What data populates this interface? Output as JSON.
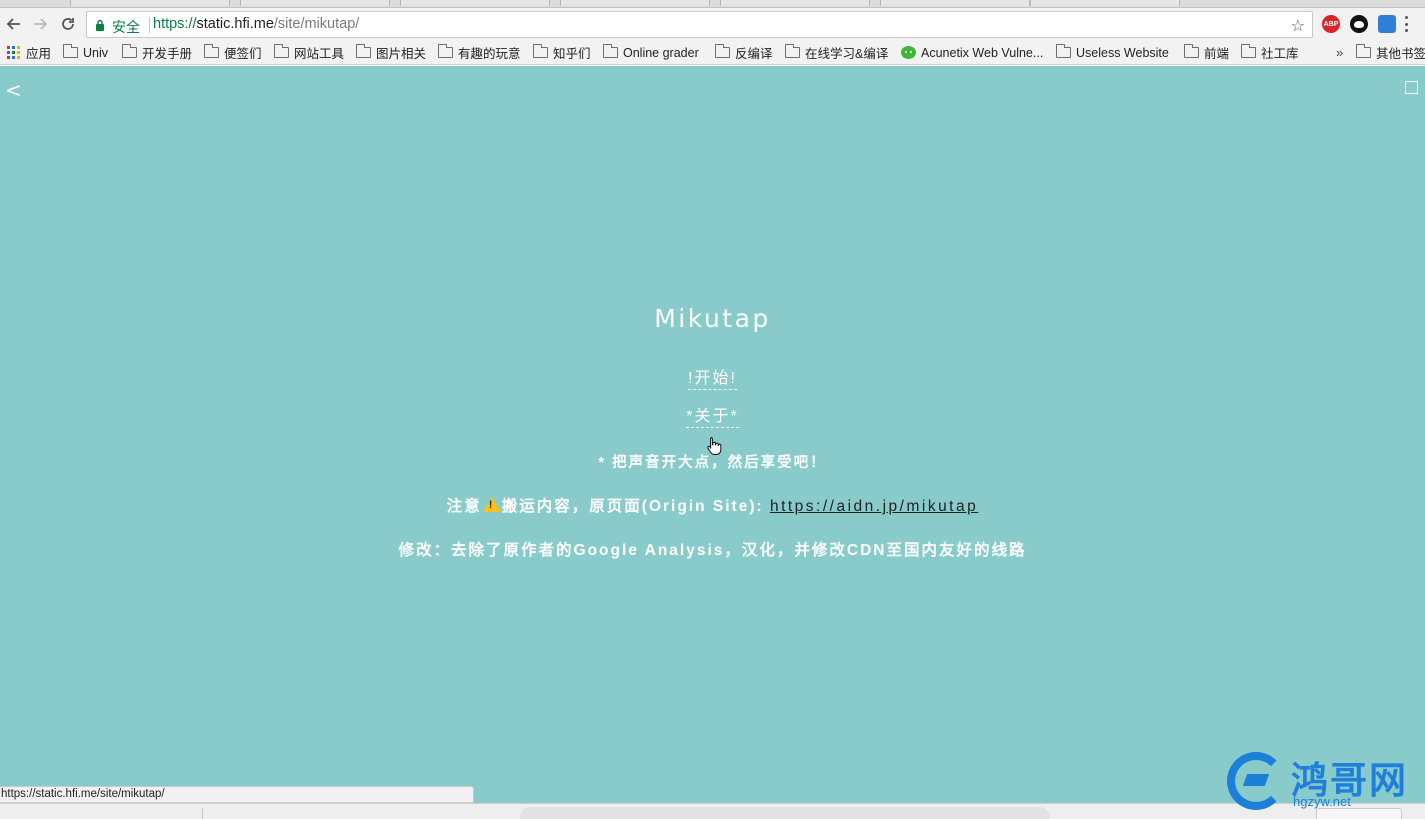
{
  "browser": {
    "omnibox": {
      "security_label": "安全",
      "url_scheme": "https://",
      "url_host": "static.hfi.me",
      "url_path": "/site/mikutap/"
    },
    "extensions": {
      "abp_label": "ABP"
    },
    "bookmarks": [
      {
        "label": "应用",
        "icon": "apps-grid-icon"
      },
      {
        "label": "Univ",
        "icon": "folder-icon"
      },
      {
        "label": "开发手册",
        "icon": "folder-icon"
      },
      {
        "label": "便签们",
        "icon": "folder-icon"
      },
      {
        "label": "网站工具",
        "icon": "folder-icon"
      },
      {
        "label": "图片相关",
        "icon": "folder-icon"
      },
      {
        "label": "有趣的玩意",
        "icon": "folder-icon"
      },
      {
        "label": "知乎们",
        "icon": "folder-icon"
      },
      {
        "label": "Online grader",
        "icon": "folder-icon"
      },
      {
        "label": "反编译",
        "icon": "folder-icon"
      },
      {
        "label": "在线学习&编译",
        "icon": "folder-icon"
      },
      {
        "label": "Acunetix Web Vulne...",
        "icon": "wechat-icon"
      },
      {
        "label": "Useless Website",
        "icon": "folder-icon"
      },
      {
        "label": "前端",
        "icon": "folder-icon"
      },
      {
        "label": "社工库",
        "icon": "folder-icon"
      }
    ],
    "overflow_label": "»",
    "other_bookmarks": "其他书签",
    "status_url": "https://static.hfi.me/site/mikutap/"
  },
  "page": {
    "background": "#88cbca",
    "back_label": "<",
    "title": "Mikutap",
    "start_label": "!开始!",
    "about_label": "*关于*",
    "hint": "* 把声音开大点，然后享受吧！",
    "notice_prefix": "注意",
    "notice_text": "搬运内容，原页面(Origin Site): ",
    "origin_url": "https://aidn.jp/mikutap",
    "modification": "修改：去除了原作者的Google Analysis，汉化，并修改CDN至国内友好的线路"
  },
  "watermark": {
    "text": "鸿哥网",
    "sub": "hgzyw.net",
    "color": "#1f7fdb"
  }
}
